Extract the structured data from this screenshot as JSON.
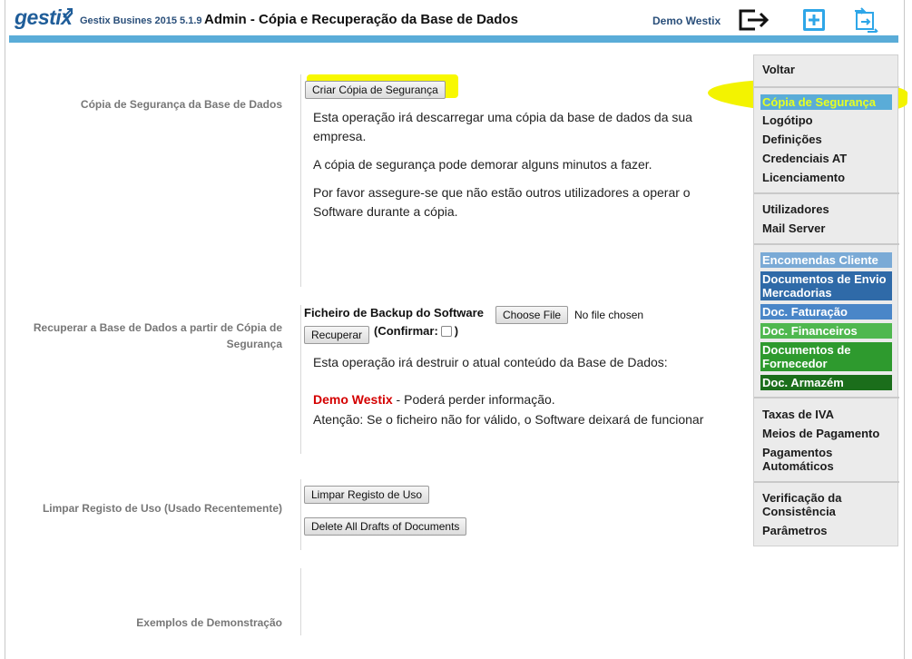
{
  "header": {
    "logo_text": "gestix",
    "app_version": "Gestix Busines 2015 5.1.9",
    "page_title": "Admin - Cópia e Recuperação da Base de Dados",
    "company_name": "Demo Westix",
    "icons": [
      "logout-icon",
      "add-icon",
      "refresh-icon"
    ],
    "accent_color": "#5aacd8"
  },
  "backup": {
    "section_label": "Cópia de Segurança da Base de Dados",
    "button_label": "Criar Cópia de Segurança",
    "text1": "Esta operação irá descarregar uma cópia da base de dados da sua empresa.",
    "text2": "A cópia de segurança pode demorar alguns minutos a fazer.",
    "text3": "Por favor assegure-se que não estão outros utilizadores a operar o Software durante a cópia."
  },
  "restore": {
    "section_label": "Recuperar a Base de Dados a partir de Cópia de Segurança",
    "file_label": "Ficheiro de Backup do Software",
    "choose_file_label": "Choose File",
    "no_file_text": "No file chosen",
    "recover_button": "Recuperar",
    "confirm_open": "(Confirmar:",
    "confirm_close": ")",
    "warning_text": "Esta operação irá destruir o atual conteúdo da Base de Dados:",
    "company_warning": "Demo Westix",
    "company_warning_suffix": " - Poderá perder informação.",
    "attention_text": "Atenção: Se o ficheiro não for válido, o Software deixará de funcionar"
  },
  "clear_log": {
    "section_label": "Limpar Registo de Uso (Usado Recentemente)",
    "clear_button": "Limpar Registo de Uso",
    "delete_drafts_button": "Delete All Drafts of Documents"
  },
  "demo": {
    "section_label": "Exemplos de Demonstração"
  },
  "menu": {
    "group1": [
      "Voltar"
    ],
    "group2": [
      "Cópia de Segurança",
      "Logótipo",
      "Definições",
      "Credenciais AT",
      "Licenciamento"
    ],
    "group3": [
      "Utilizadores",
      "Mail Server"
    ],
    "group4": [
      {
        "label": "Encomendas Cliente",
        "color": "#7aaad6"
      },
      {
        "label": "Documentos de Envio Mercadorias",
        "color": "#2f6aa8"
      },
      {
        "label": "Doc. Faturação",
        "color": "#4a86c8"
      },
      {
        "label": "Doc. Financeiros",
        "color": "#4fb84f"
      },
      {
        "label": "Documentos de Fornecedor",
        "color": "#2e9a2e"
      },
      {
        "label": "Doc. Armazém",
        "color": "#1b6e1b"
      }
    ],
    "group5": [
      "Taxas de IVA",
      "Meios de Pagamento",
      "Pagamentos Automáticos"
    ],
    "group6": [
      "Verificação da Consistência",
      "Parâmetros"
    ],
    "active_item_color": "#5aacd8"
  }
}
